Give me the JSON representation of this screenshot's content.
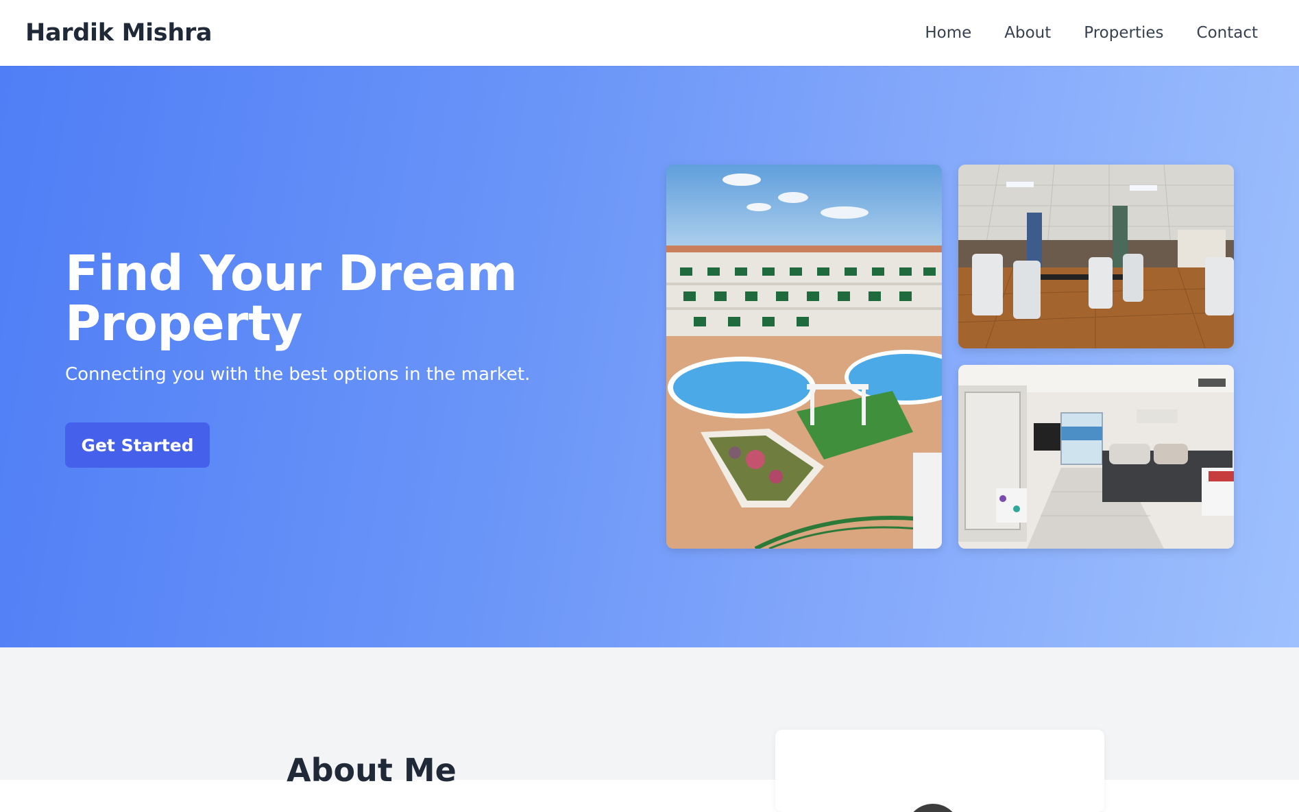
{
  "header": {
    "brand": "Hardik Mishra",
    "nav": [
      "Home",
      "About",
      "Properties",
      "Contact"
    ]
  },
  "hero": {
    "title": "Find Your Dream Property",
    "subtitle": "Connecting you with the best options in the market.",
    "cta_label": "Get Started",
    "photos": [
      "resort-pool-photo",
      "dining-room-photo",
      "living-room-photo"
    ]
  },
  "about": {
    "title": "About Me"
  },
  "colors": {
    "hero_gradient_start": "#4f7ef6",
    "hero_gradient_end": "#9ec0fd",
    "cta_bg": "#4561ec",
    "heading_text": "#1f2937",
    "section_bg": "#f3f4f6"
  }
}
